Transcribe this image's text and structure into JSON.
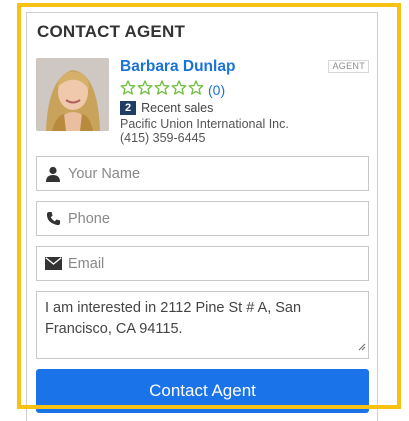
{
  "widget": {
    "title": "CONTACT AGENT",
    "badge": "AGENT"
  },
  "agent": {
    "name": "Barbara Dunlap",
    "rating_count": "(0)",
    "stars_filled": 0,
    "stars_total": 5,
    "recent_sales_count": "2",
    "recent_sales_label": "Recent sales",
    "brokerage": "Pacific Union International Inc.",
    "phone": "(415) 359-6445"
  },
  "form": {
    "name_placeholder": "Your Name",
    "phone_placeholder": "Phone",
    "email_placeholder": "Email",
    "message": "I am interested in 2112 Pine St # A, San Francisco, CA 94115.",
    "submit_label": "Contact Agent"
  },
  "colors": {
    "accent": "#1a73e8",
    "name_link": "#1a73d6",
    "star_outline": "#6fbf3f",
    "sales_badge": "#1f3e66",
    "highlight": "#f7c213"
  }
}
